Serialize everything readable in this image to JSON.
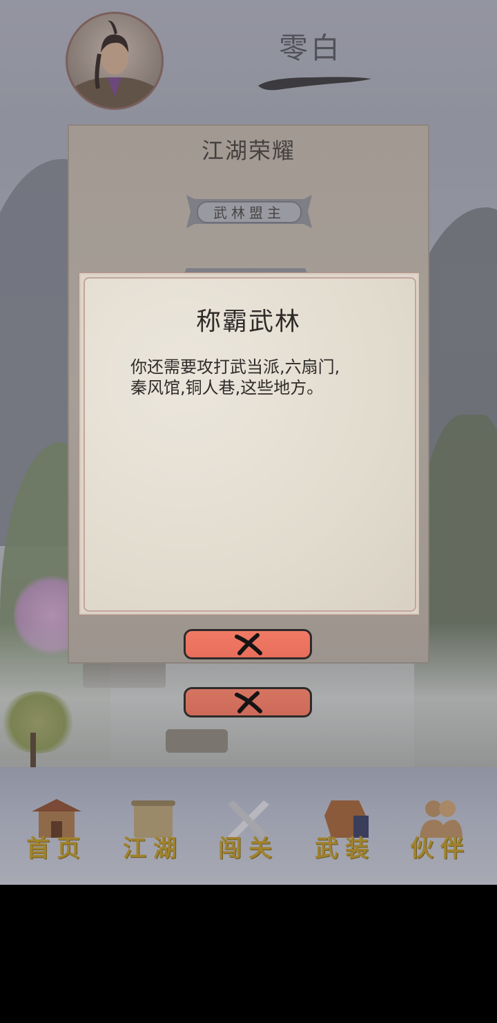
{
  "header": {
    "player_name": "零白",
    "avatar_icon": "character-portrait"
  },
  "panel": {
    "title": "江湖荣耀",
    "rank_title": "武林盟主"
  },
  "dialog": {
    "title": "称霸武林",
    "message_line1": "你还需要攻打武当派,六扇门,",
    "message_line2": "秦风馆,铜人巷,这些地方。",
    "close_icon": "close-x-icon"
  },
  "nav": {
    "items": [
      {
        "label": "首页",
        "icon": "temple-icon"
      },
      {
        "label": "江湖",
        "icon": "scroll-map-icon"
      },
      {
        "label": "闯关",
        "icon": "crossed-swords-icon"
      },
      {
        "label": "武装",
        "icon": "armor-icon"
      },
      {
        "label": "伙伴",
        "icon": "companions-icon"
      }
    ]
  },
  "colors": {
    "button_red": "#f07a65",
    "nav_gold": "#a0822e",
    "panel_paper": "#c0b6a9"
  }
}
